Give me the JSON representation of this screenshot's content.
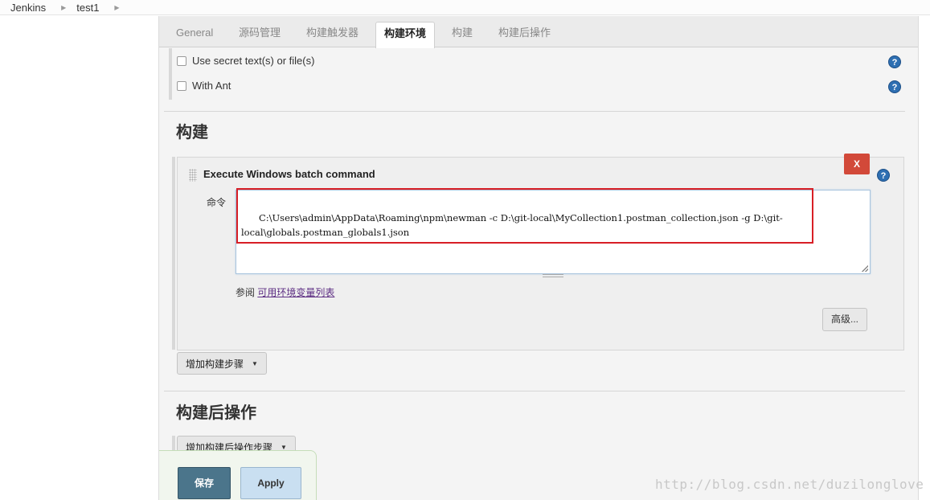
{
  "breadcrumb": {
    "items": [
      "Jenkins",
      "test1"
    ]
  },
  "tabs": [
    {
      "label": "General"
    },
    {
      "label": "源码管理"
    },
    {
      "label": "构建触发器"
    },
    {
      "label": "构建环境",
      "active": true
    },
    {
      "label": "构建"
    },
    {
      "label": "构建后操作"
    }
  ],
  "build_env": {
    "options": [
      {
        "label": "Use secret text(s) or file(s)",
        "checked": false
      },
      {
        "label": "With Ant",
        "checked": false
      }
    ]
  },
  "build": {
    "title": "构建",
    "step": {
      "title": "Execute Windows batch command",
      "delete_label": "X",
      "command_label": "命令",
      "command_value": "C:\\Users\\admin\\AppData\\Roaming\\npm\\newman -c D:\\git-local\\MyCollection1.postman_collection.json -g D:\\git-local\\globals.postman_globals1.json",
      "see_also_prefix": "参阅 ",
      "see_also_link": "可用环境变量列表",
      "advanced_label": "高级..."
    },
    "add_step_label": "增加构建步骤"
  },
  "post_build": {
    "title": "构建后操作",
    "add_step_label": "增加构建后操作步骤"
  },
  "actions": {
    "save_label": "保存",
    "apply_label": "Apply"
  },
  "help_icon_label": "?",
  "watermark": "http://blog.csdn.net/duzilonglove",
  "colors": {
    "save": "#4b758b",
    "apply": "#c9dff1",
    "delete": "#d24939",
    "highlight": "#d81f26"
  }
}
